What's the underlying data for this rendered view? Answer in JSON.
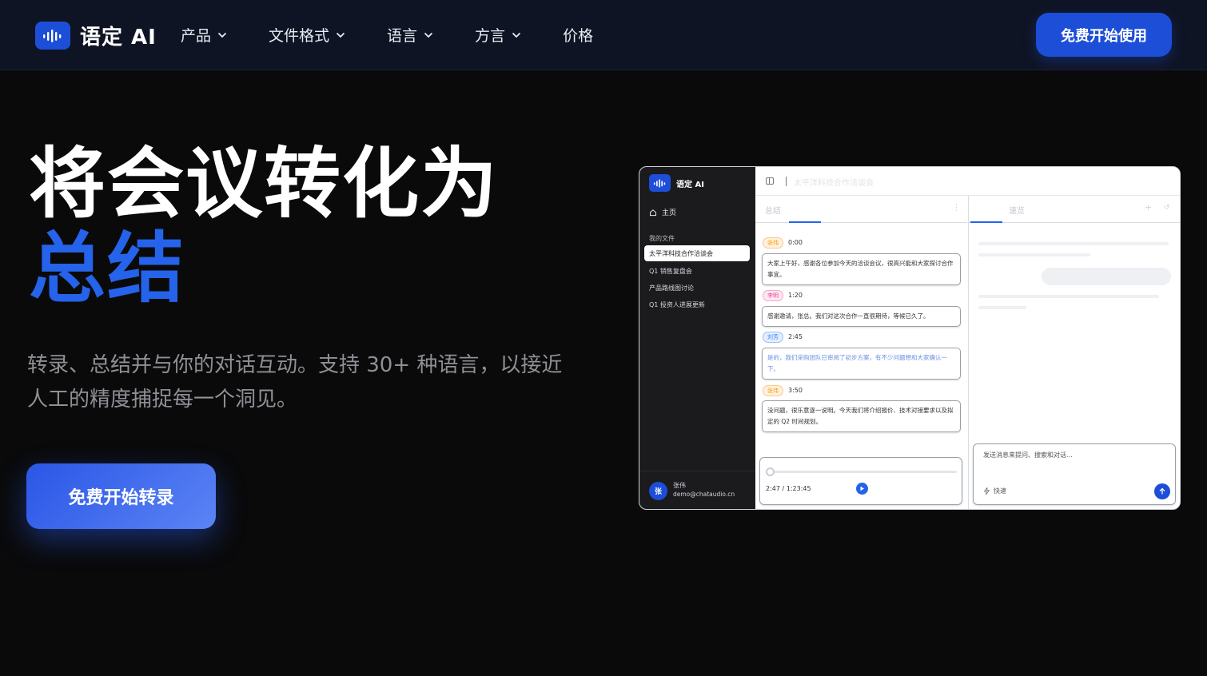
{
  "nav": {
    "logo_text": "语定 AI",
    "menu": [
      {
        "label": "产品",
        "has_dropdown": true
      },
      {
        "label": "文件格式",
        "has_dropdown": true
      },
      {
        "label": "语言",
        "has_dropdown": true
      },
      {
        "label": "方言",
        "has_dropdown": true
      },
      {
        "label": "价格",
        "has_dropdown": false
      }
    ],
    "cta_label": "免费开始使用"
  },
  "hero": {
    "title_line1": "将会议转化为",
    "title_line2": "总结",
    "subtitle": "转录、总结并与你的对话互动。支持 30+ 种语言，以接近人工的精度捕捉每一个洞见。",
    "cta_label": "免费开始转录"
  },
  "app": {
    "logo_text": "语定 AI",
    "home_label": "主页",
    "files_section": "我的文件",
    "files": [
      {
        "label": "太平洋科技合作洽谈会",
        "active": true
      },
      {
        "label": "Q1 销售复盘会",
        "active": false
      },
      {
        "label": "产品路线图讨论",
        "active": false
      },
      {
        "label": "Q1 投资人进展更新",
        "active": false
      }
    ],
    "user": {
      "initial": "张",
      "name": "张伟",
      "email": "demo@chataudio.cn"
    },
    "document_title": "太平洋科技合作洽谈会",
    "left_tab": "总结",
    "right_tab": "速览",
    "segments": [
      {
        "speaker": "张伟",
        "time": "0:00",
        "text": "大家上午好，感谢各位参加今天的洽谈会议，很高兴能和大家探讨合作事宜。",
        "speaker_color": "#f59e0b"
      },
      {
        "speaker": "李明",
        "time": "1:20",
        "text": "感谢邀请，张总。我们对这次合作一直很期待，等候已久了。",
        "speaker_color": "#ec4899"
      },
      {
        "speaker": "刘芳",
        "time": "2:45",
        "text": "是的，我们采购团队已审阅了初步方案，有不少问题想和大家确认一下。",
        "speaker_color": "#3b82f6"
      },
      {
        "speaker": "张伟",
        "time": "3:50",
        "text": "没问题，很乐意逐一说明。今天我们将介绍报价、技术对接要求以及拟定的 Q2 时间规划。",
        "speaker_color": "#f59e0b"
      }
    ],
    "player": {
      "time": "2:47 / 1:23:45",
      "progress": 0.035
    },
    "chat": {
      "placeholder": "发送消息来提问、搜索和对话...",
      "quick_label": "快速"
    }
  }
}
